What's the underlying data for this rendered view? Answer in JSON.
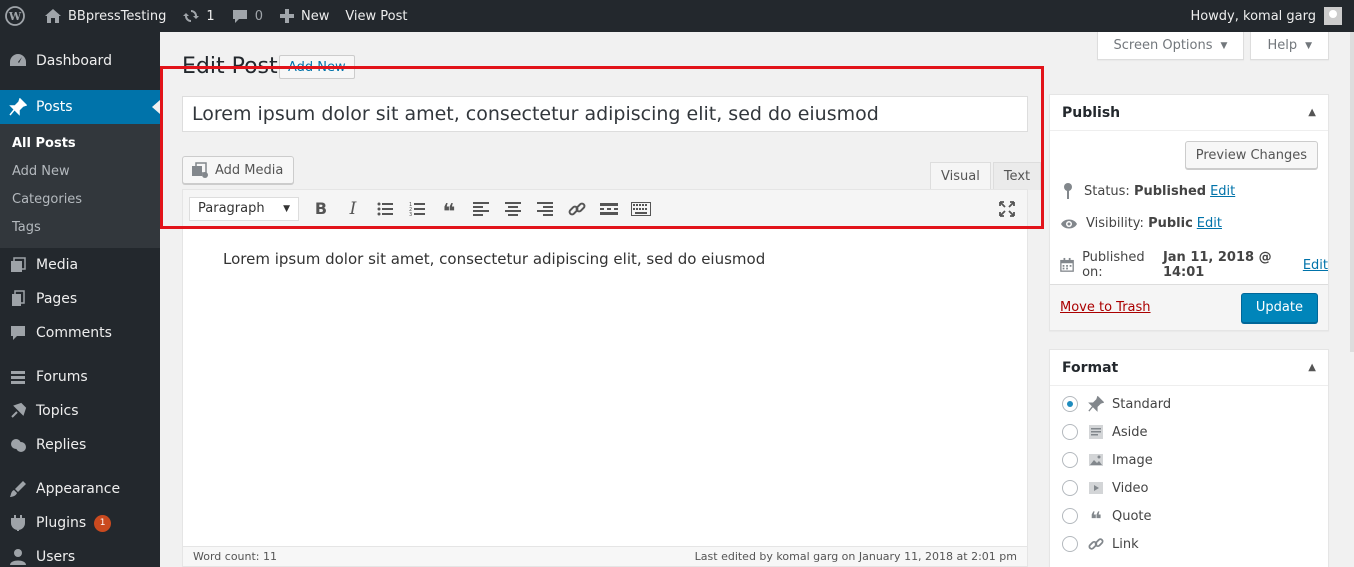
{
  "adminbar": {
    "site_name": "BBpressTesting",
    "updates_count": "1",
    "comments_count": "0",
    "new_label": "New",
    "view_post_label": "View Post",
    "greeting": "Howdy, komal garg"
  },
  "sidebar": {
    "items": [
      {
        "label": "Dashboard",
        "icon": "dashboard-icon"
      },
      {
        "label": "Posts",
        "icon": "pin-icon"
      },
      {
        "label": "Media",
        "icon": "media-icon"
      },
      {
        "label": "Pages",
        "icon": "pages-icon"
      },
      {
        "label": "Comments",
        "icon": "comment-icon"
      },
      {
        "label": "Forums",
        "icon": "forums-icon"
      },
      {
        "label": "Topics",
        "icon": "topics-icon"
      },
      {
        "label": "Replies",
        "icon": "replies-icon"
      },
      {
        "label": "Appearance",
        "icon": "brush-icon"
      },
      {
        "label": "Plugins",
        "icon": "plugin-icon",
        "badge": "1"
      },
      {
        "label": "Users",
        "icon": "users-icon"
      }
    ],
    "submenu": [
      "All Posts",
      "Add New",
      "Categories",
      "Tags"
    ]
  },
  "screen_options": "Screen Options",
  "help": "Help",
  "page": {
    "title": "Edit Post",
    "add_new": "Add New",
    "post_title": "Lorem ipsum dolor sit amet, consectetur adipiscing elit, sed do eiusmod"
  },
  "editor": {
    "add_media": "Add Media",
    "tab_visual": "Visual",
    "tab_text": "Text",
    "format": "Paragraph",
    "content": "Lorem ipsum dolor sit amet, consectetur adipiscing elit, sed do eiusmod",
    "word_count": "Word count: 11",
    "last_edited": "Last edited by komal garg on January 11, 2018 at 2:01 pm"
  },
  "publish": {
    "heading": "Publish",
    "preview": "Preview Changes",
    "status_label": "Status:",
    "status_value": "Published",
    "visibility_label": "Visibility:",
    "visibility_value": "Public",
    "published_label": "Published on:",
    "published_value": "Jan 11, 2018 @ 14:01",
    "edit": "Edit",
    "trash": "Move to Trash",
    "update": "Update"
  },
  "format_box": {
    "heading": "Format",
    "options": [
      "Standard",
      "Aside",
      "Image",
      "Video",
      "Quote",
      "Link"
    ],
    "selected": "Standard"
  },
  "colors": {
    "accent": "#0073aa",
    "highlight": "#e2131a",
    "sidebar": "#23282d"
  }
}
